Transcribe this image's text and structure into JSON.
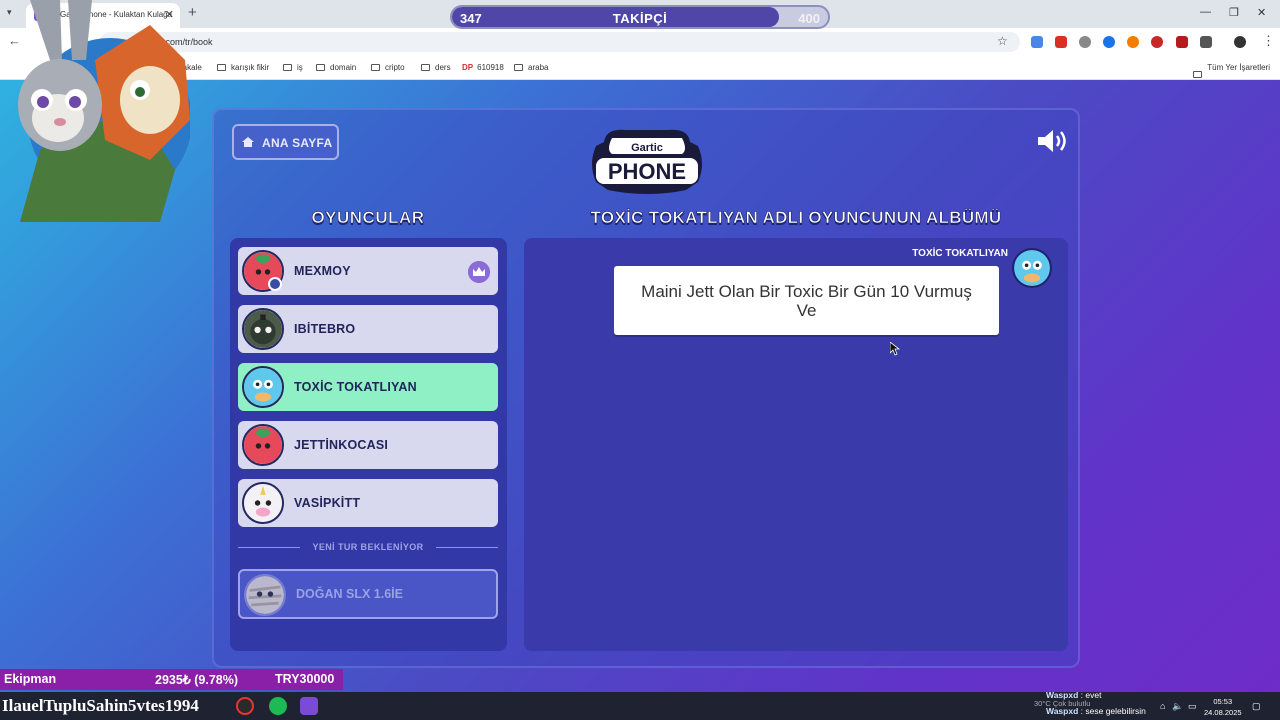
{
  "browser": {
    "tab_title": "Gartic Phone - Kulaktan Kulağa",
    "url": "garticphone.com/tr/book",
    "bookmarks": [
      "makale",
      "karışık fikir",
      "iş",
      "domain",
      "cripto",
      "ders",
      "610918",
      "araba"
    ],
    "all_bookmarks": "Tüm Yer İşaretleri"
  },
  "follower_bar": {
    "current": "347",
    "label": "TAKİPÇİ",
    "goal": "400",
    "progress": 0.87
  },
  "game": {
    "home_button": "ANA SAYFA",
    "logo_top": "Gartic",
    "logo_bottom": "PHONE",
    "players_title": "OYUNCULAR",
    "album_title": "TOXİC TOKATLIYAN ADLI OYUNCUNUN ALBÜMÜ",
    "players": [
      {
        "name": "MEXMOY",
        "avatar": "strawberry-avatar",
        "host": true,
        "active": false
      },
      {
        "name": "IBİTEBRO",
        "avatar": "bomb-avatar",
        "host": false,
        "active": false
      },
      {
        "name": "TOXİC TOKATLIYAN",
        "avatar": "blue-blob-avatar",
        "host": false,
        "active": true
      },
      {
        "name": "JETTİNKOCASI",
        "avatar": "strawberry-avatar",
        "host": false,
        "active": false
      },
      {
        "name": "VASİPKİTT",
        "avatar": "unicorn-avatar",
        "host": false,
        "active": false
      }
    ],
    "waiting_label": "YENİ TUR BEKLENİYOR",
    "waiting_player": {
      "name": "DOĞAN SLX 1.6İE",
      "avatar": "mummy-avatar"
    },
    "album": {
      "author": "TOXİC TOKATLIYAN",
      "entry_text": "Maini Jett Olan Bir Toxic Bir Gün 10 Vurmuş Ve"
    }
  },
  "stream_overlay": {
    "ticker_name": "Ekipman",
    "ticker_change": "2935₺ (9.78%)",
    "ticker_target": "TRY30000",
    "taskbar_text": "IlauelTupluSahin5vtes1994",
    "chat": [
      {
        "user": "Waspxd",
        "message": "evet"
      },
      {
        "user": "Waspxd",
        "message": "sese gelebilirsin"
      }
    ],
    "weather": "30°C  Çok bulutlu",
    "time": "05:53",
    "date": "24.08.2025"
  },
  "colors": {
    "active_player": "#8ef0c4",
    "panel": "#3238a6",
    "ticker": "#8a1fa8"
  }
}
